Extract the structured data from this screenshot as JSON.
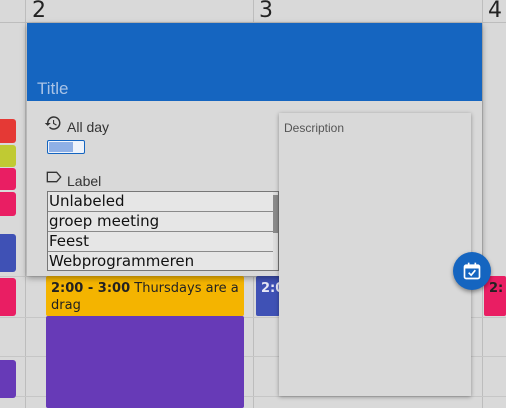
{
  "calendar": {
    "day_numbers": [
      "2",
      "3",
      "4"
    ],
    "events": [
      {
        "time": "2:00 - 3:00",
        "title": "Thursdays are a drag"
      },
      {
        "time": "2:0",
        "title": ""
      },
      {
        "time": "2:",
        "title": ""
      }
    ],
    "colors": {
      "yellow_event": "#f4b400",
      "purple_event": "#673ab7",
      "indigo_event": "#3f51b5",
      "pink_event": "#e91e63"
    }
  },
  "modal": {
    "title_placeholder": "Title",
    "all_day_label": "All day",
    "all_day_icon": "history-icon",
    "label_field_label": "Label",
    "label_icon": "label-tag-icon",
    "label_options": [
      "Unlabeled",
      "groep meeting",
      "Feest",
      "Webprogrammeren"
    ],
    "description_label": "Description",
    "header_color": "#1565c0"
  },
  "fab": {
    "icon": "calendar-check-icon"
  }
}
